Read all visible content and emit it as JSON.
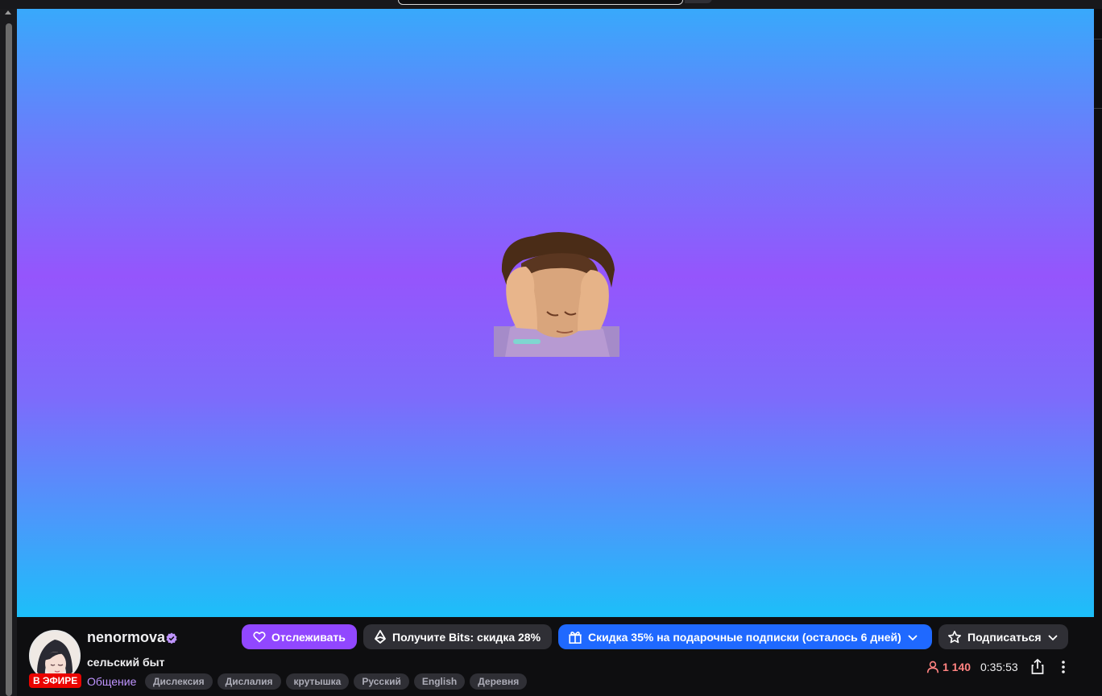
{
  "stream": {
    "channel_name": "nenormova",
    "title": "сельский быт",
    "category": "Общение",
    "live_badge": "В ЭФИРЕ",
    "tags": [
      "Дислексия",
      "Дислалия",
      "крутышка",
      "Русский",
      "English",
      "Деревня"
    ],
    "viewer_count": "1 140",
    "uptime": "0:35:53"
  },
  "actions": {
    "follow_label": "Отслеживать",
    "bits_label": "Получите Bits: скидка 28%",
    "gift_label": "Скидка 35% на подарочные подписки (осталось 6 дней)",
    "subscribe_label": "Подписаться"
  },
  "colors": {
    "accent_purple": "#9147ff",
    "gift_blue": "#1f69ff",
    "live_red": "#eb0400",
    "viewer_red": "#ff8280",
    "category_purple": "#bf94ff"
  },
  "icons": {
    "follow": "heart-icon",
    "bits": "bits-gem-icon",
    "gift": "gift-icon",
    "subscribe": "star-icon",
    "viewers": "person-icon",
    "share": "share-icon",
    "more": "more-vertical-icon",
    "verified": "verified-badge-icon"
  }
}
